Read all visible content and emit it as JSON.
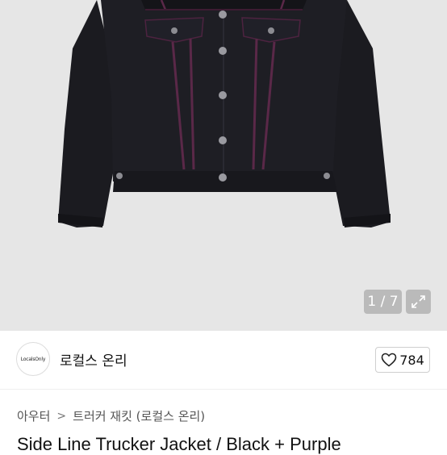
{
  "image_gallery": {
    "counter": "1 / 7",
    "expand_icon": "expand-icon"
  },
  "seller": {
    "logo_text": "LocalsOnly",
    "name": "로컬스 온리",
    "like_icon": "heart-outline-icon",
    "like_count": "784"
  },
  "breadcrumb": {
    "items": [
      "아우터",
      "트러커 재킷 (로컬스 온리)"
    ],
    "separator": ">"
  },
  "product": {
    "title": "Side Line Trucker Jacket / Black + Purple"
  },
  "colors": {
    "photo_background": "#e6e6e6",
    "jacket": "#1c1c22",
    "stitch": "#5a2848"
  }
}
